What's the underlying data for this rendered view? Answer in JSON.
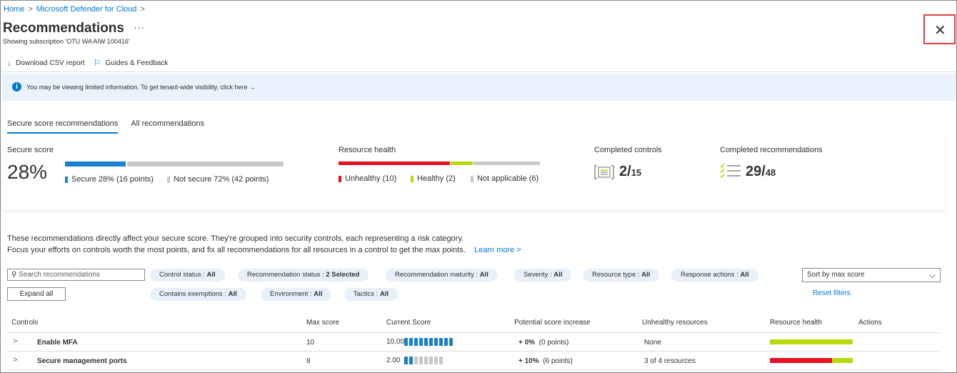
{
  "breadcrumb": {
    "home": "Home",
    "sep": ">",
    "defender": "Microsoft Defender for Cloud",
    "sep2": ">"
  },
  "page": {
    "title": "Recommendations",
    "ellipsis": "···",
    "subtitle": "Showing subscription 'OTU WA AIW 100416'",
    "close": "✕"
  },
  "toolbar": {
    "download": "Download CSV report",
    "guides": "Guides & Feedback",
    "download_icon": "↓",
    "guides_icon": "⚐"
  },
  "banner": {
    "icon": "i",
    "text": "You may be viewing limited information. To get tenant-wide visibility, click here →"
  },
  "tabs": [
    {
      "label": "Secure score recommendations",
      "active": true
    },
    {
      "label": "All recommendations",
      "active": false
    }
  ],
  "score": {
    "label": "Secure score",
    "value": "28%",
    "secure": "Secure 28% (16 points)",
    "not_secure": "Not secure 72% (42 points)",
    "secure_fraction": 0.28,
    "color_secure": "#1b7fd0",
    "color_not": "#c8c8c8"
  },
  "health": {
    "label": "Resource health",
    "unhealthy": "Unhealthy (10)",
    "healthy": "Healthy (2)",
    "na": "Not applicable (6)",
    "unhealthy_n": 10,
    "healthy_n": 2,
    "na_n": 6,
    "color_unhealthy": "#e81123",
    "color_healthy": "#bad80a",
    "color_na": "#c8c8c8"
  },
  "controls": {
    "label": "Completed controls",
    "value": "2",
    "total": "15",
    "sep": "/"
  },
  "recs": {
    "label": "Completed recommendations",
    "value": "29",
    "total": "48",
    "sep": "/"
  },
  "desc": {
    "line1": "These recommendations directly affect your secure score. They're grouped into security controls, each representing a risk category.",
    "line2": "Focus your efforts on controls worth the most points, and fix all recommendations for all resources in a control to get the max points.",
    "learn": "Learn more >"
  },
  "search": {
    "placeholder": "Search recommendations",
    "icon": "⚲"
  },
  "expand": "Expand all",
  "filters": {
    "control_status": {
      "k": "Control status : ",
      "v": "All"
    },
    "rec_status": {
      "k": "Recommendation status : ",
      "v": "2 Selected"
    },
    "maturity": {
      "k": "Recommendation maturity : ",
      "v": "All"
    },
    "severity": {
      "k": "Severity : ",
      "v": "All"
    },
    "resource_type": {
      "k": "Resource type : ",
      "v": "All"
    },
    "response": {
      "k": "Response actions : ",
      "v": "All"
    },
    "exemptions": {
      "k": "Contains exemptions : ",
      "v": "All"
    },
    "environment": {
      "k": "Environment : ",
      "v": "All"
    },
    "tactics": {
      "k": "Tactics : ",
      "v": "All"
    }
  },
  "sort": {
    "label": "Sort by max score",
    "chev": "⌵"
  },
  "reset": "Reset filters",
  "table": {
    "headers": {
      "controls": "Controls",
      "max": "Max score",
      "current": "Current Score",
      "potential": "Potential score increase",
      "unhealthy": "Unhealthy resources",
      "health": "Resource health",
      "actions": "Actions"
    },
    "rows": [
      {
        "name": "Enable MFA",
        "max": "10",
        "current": "10.00",
        "filled": 10,
        "total": 10,
        "inc": "+ 0%",
        "pts": "(0 points)",
        "unhealthy": "None",
        "unhealthy_frac": 0.0
      },
      {
        "name": "Secure management ports",
        "max": "8",
        "current": "2.00",
        "filled": 2,
        "total": 8,
        "inc": "+ 10%",
        "pts": "(6 points)",
        "unhealthy": "3 of 4 resources",
        "unhealthy_frac": 0.75
      }
    ]
  }
}
